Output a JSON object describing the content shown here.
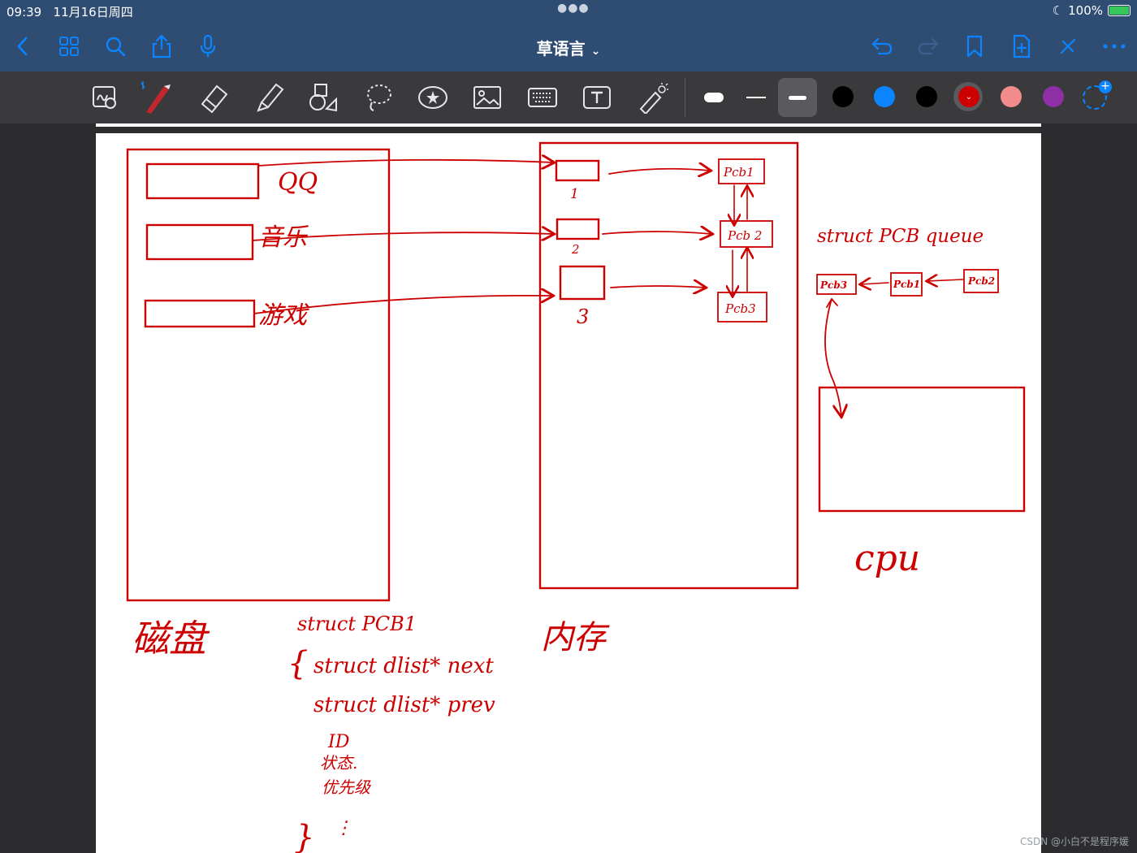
{
  "status": {
    "time": "09:39",
    "date": "11月16日周四",
    "battery": "100%"
  },
  "document": {
    "title": "草语言"
  },
  "colors": {
    "ink_red": "#cc0000",
    "nav_bg": "#2f4d73",
    "toolbar_bg": "#3a3a3c",
    "accent_blue": "#0a84ff"
  },
  "toolbar": {
    "tools": [
      "zoom-box-icon",
      "pen-icon",
      "eraser-icon",
      "highlighter-icon",
      "shapes-icon",
      "lasso-icon",
      "sticker-icon",
      "image-icon",
      "keyboard-icon",
      "text-box-icon",
      "laser-pointer-icon"
    ],
    "swatches": [
      "#000000",
      "#0a84ff",
      "#000000",
      "#cc0000",
      "#f28b8b",
      "#8e2fa6"
    ]
  },
  "diagram": {
    "disk_label": "磁盘",
    "memory_label": "内存",
    "cpu_label": "cpu",
    "disk_items": [
      "QQ",
      "音乐",
      "游戏"
    ],
    "memory_slots": [
      "1",
      "2",
      "3"
    ],
    "pcb_nodes": [
      "Pcb1",
      "Pcb 2",
      "Pcb3"
    ],
    "queue_title": "struct PCB  queue",
    "queue_nodes": [
      "Pcb3",
      "Pcb1",
      "Pcb2"
    ],
    "struct_lines": [
      "struct PCB1",
      "{",
      "struct dlist* next",
      "struct dlist* prev",
      "ID",
      "状态.",
      "优先级",
      "⋮",
      "}"
    ]
  },
  "watermark": "CSDN @小白不是程序媛"
}
